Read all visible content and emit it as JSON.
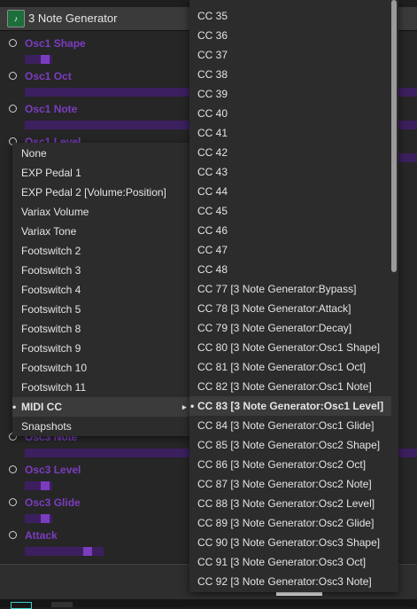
{
  "window": {
    "title": "3 Note Generator",
    "icon": "plugin-logo-icon"
  },
  "parameters": [
    {
      "label": "Osc1 Shape",
      "track": 0.07,
      "value": 0.04
    },
    {
      "label": "Osc1 Oct",
      "track": 1.0,
      "value": null
    },
    {
      "label": "Osc1 Note",
      "track": 1.0,
      "value": null
    },
    {
      "label": "Osc1 Level",
      "track": 1.0,
      "value": null
    },
    {
      "label": "Osc3 Note",
      "track": 1.0,
      "value": null
    },
    {
      "label": "Osc3 Level",
      "track": 0.07,
      "value": 0.04
    },
    {
      "label": "Osc3 Glide",
      "track": 0.07,
      "value": 0.04
    },
    {
      "label": "Attack",
      "track": 0.2,
      "value": 0.15
    }
  ],
  "menu": {
    "items": [
      {
        "label": "None"
      },
      {
        "label": "EXP Pedal 1"
      },
      {
        "label": "EXP Pedal 2 [Volume:Position]"
      },
      {
        "label": "Variax Volume"
      },
      {
        "label": "Variax Tone"
      },
      {
        "label": "Footswitch 2"
      },
      {
        "label": "Footswitch 3"
      },
      {
        "label": "Footswitch 4"
      },
      {
        "label": "Footswitch 5"
      },
      {
        "label": "Footswitch 8"
      },
      {
        "label": "Footswitch 9"
      },
      {
        "label": "Footswitch 10"
      },
      {
        "label": "Footswitch 11"
      },
      {
        "label": "MIDI CC",
        "selected": true,
        "submenu_arrow": "▸"
      },
      {
        "label": "Snapshots"
      }
    ],
    "selected_bullet": "•"
  },
  "submenu": {
    "items": [
      {
        "label": "CC 35"
      },
      {
        "label": "CC 36"
      },
      {
        "label": "CC 37"
      },
      {
        "label": "CC 38"
      },
      {
        "label": "CC 39"
      },
      {
        "label": "CC 40"
      },
      {
        "label": "CC 41"
      },
      {
        "label": "CC 42"
      },
      {
        "label": "CC 43"
      },
      {
        "label": "CC 44"
      },
      {
        "label": "CC 45"
      },
      {
        "label": "CC 46"
      },
      {
        "label": "CC 47"
      },
      {
        "label": "CC 48"
      },
      {
        "label": "CC 77 [3 Note Generator:Bypass]"
      },
      {
        "label": "CC 78 [3 Note Generator:Attack]"
      },
      {
        "label": "CC 79 [3 Note Generator:Decay]"
      },
      {
        "label": "CC 80 [3 Note Generator:Osc1 Shape]"
      },
      {
        "label": "CC 81 [3 Note Generator:Osc1 Oct]"
      },
      {
        "label": "CC 82 [3 Note Generator:Osc1 Note]"
      },
      {
        "label": "CC 83 [3 Note Generator:Osc1 Level]",
        "selected": true
      },
      {
        "label": "CC 84 [3 Note Generator:Osc1 Glide]"
      },
      {
        "label": "CC 85 [3 Note Generator:Osc2 Shape]"
      },
      {
        "label": "CC 86 [3 Note Generator:Osc2 Oct]"
      },
      {
        "label": "CC 87 [3 Note Generator:Osc2 Note]"
      },
      {
        "label": "CC 88 [3 Note Generator:Osc2 Level]"
      },
      {
        "label": "CC 89 [3 Note Generator:Osc2 Glide]"
      },
      {
        "label": "CC 90 [3 Note Generator:Osc3 Shape]"
      },
      {
        "label": "CC 91 [3 Note Generator:Osc3 Oct]"
      },
      {
        "label": "CC 92 [3 Note Generator:Osc3 Note]"
      }
    ],
    "selected_bullet": "•",
    "scroll_position": 0.0
  },
  "colors": {
    "accent_purple": "#7b3cc0",
    "track_purple": "#3c1f5e",
    "menu_bg": "#2c2c2c",
    "menu_highlight": "#3b3b3b"
  }
}
